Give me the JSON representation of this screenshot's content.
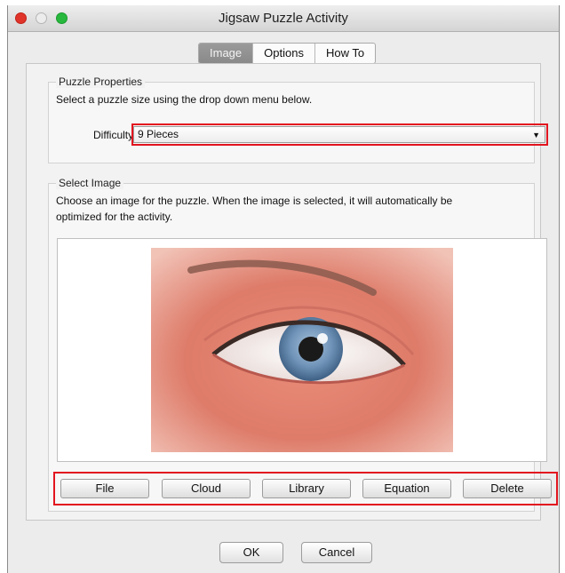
{
  "window": {
    "title": "Jigsaw Puzzle Activity"
  },
  "tabs": [
    {
      "label": "Image",
      "active": true
    },
    {
      "label": "Options",
      "active": false
    },
    {
      "label": "How To",
      "active": false
    }
  ],
  "puzzle_properties": {
    "legend": "Puzzle Properties",
    "description": "Select a puzzle size using the drop down menu below.",
    "difficulty_label": "Difficulty:",
    "difficulty_value": "9 Pieces"
  },
  "select_image": {
    "legend": "Select Image",
    "description_line1": "Choose an image for the puzzle. When the image is selected, it will automatically be",
    "description_line2": "optimized for the activity.",
    "preview_icon": "eye-illustration",
    "buttons": {
      "file": "File",
      "cloud": "Cloud",
      "library": "Library",
      "equation": "Equation",
      "delete": "Delete"
    }
  },
  "footer": {
    "ok": "OK",
    "cancel": "Cancel"
  },
  "colors": {
    "highlight": "#e2141f",
    "close_button": "#e0342b",
    "maximize_button": "#27b83d",
    "active_tab": "#8f8f8f"
  }
}
